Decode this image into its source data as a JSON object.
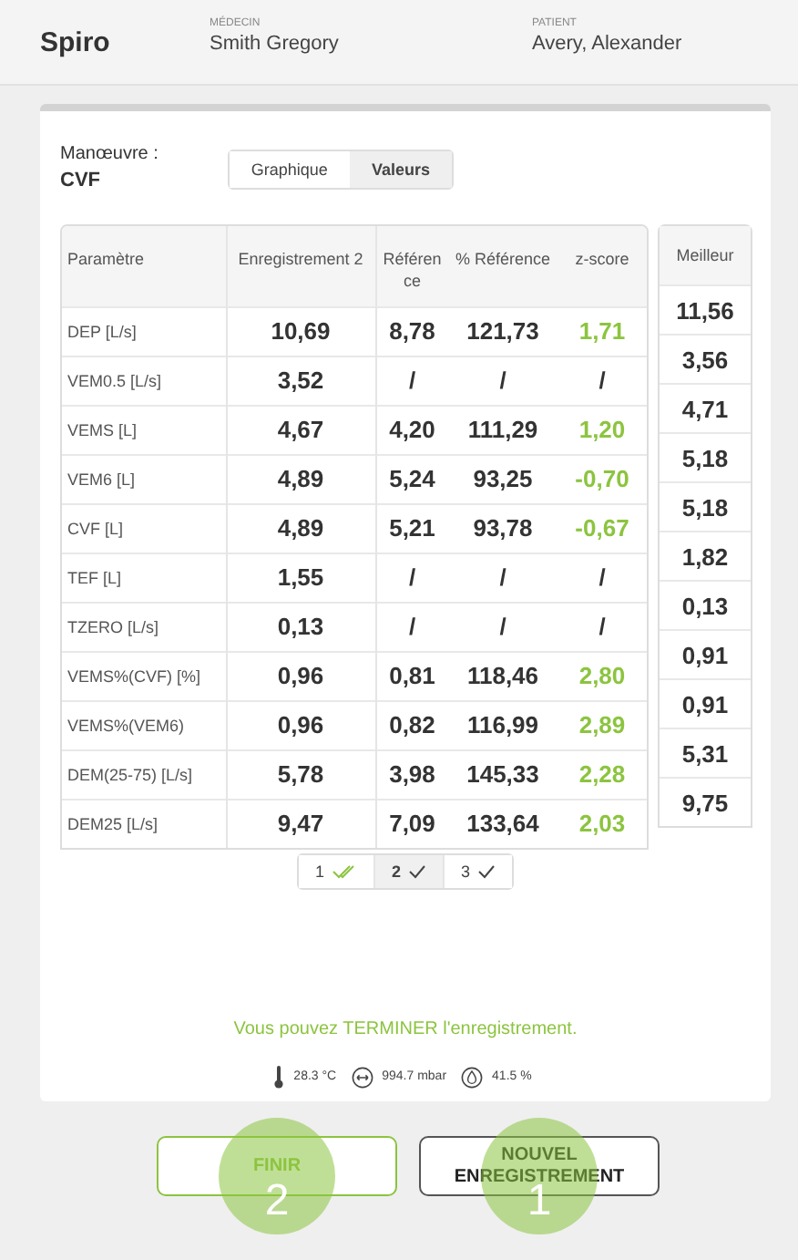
{
  "header": {
    "title": "Spiro",
    "doctor_label": "MÉDECIN",
    "doctor": "Smith Gregory",
    "patient_label": "PATIENT",
    "patient": "Avery, Alexander"
  },
  "maneuver": {
    "label": "Manœuvre :",
    "value": "CVF"
  },
  "view_tabs": [
    {
      "label": "Graphique",
      "selected": false
    },
    {
      "label": "Valeurs",
      "selected": true
    }
  ],
  "table": {
    "columns": [
      "Paramètre",
      "Enregistrement 2",
      "Référence",
      "% Référence",
      "z-score"
    ],
    "rows": [
      {
        "parameter": "DEP [L/s]",
        "recording": "10,69",
        "reference": "8,78",
        "percent": "121,73",
        "z_score": "1,71",
        "color": "#8cc43f"
      },
      {
        "parameter": "VEM0.5 [L/s]",
        "recording": "3,52",
        "reference": "/",
        "percent": "/",
        "z_score": "/",
        "color": "#333333"
      },
      {
        "parameter": "VEMS [L]",
        "recording": "4,67",
        "reference": "4,20",
        "percent": "111,29",
        "z_score": "1,20",
        "color": "#8cc43f"
      },
      {
        "parameter": "VEM6 [L]",
        "recording": "4,89",
        "reference": "5,24",
        "percent": "93,25",
        "z_score": "-0,70",
        "color": "#8cc43f"
      },
      {
        "parameter": "CVF [L]",
        "recording": "4,89",
        "reference": "5,21",
        "percent": "93,78",
        "z_score": "-0,67",
        "color": "#8cc43f"
      },
      {
        "parameter": "TEF [L]",
        "recording": "1,55",
        "reference": "/",
        "percent": "/",
        "z_score": "/",
        "color": "#333333"
      },
      {
        "parameter": "TZERO [L/s]",
        "recording": "0,13",
        "reference": "/",
        "percent": "/",
        "z_score": "/",
        "color": "#333333"
      },
      {
        "parameter": "VEMS%(CVF) [%]",
        "recording": "0,96",
        "reference": "0,81",
        "percent": "118,46",
        "z_score": "2,80",
        "color": "#8cc43f"
      },
      {
        "parameter": "VEMS%(VEM6)",
        "recording": "0,96",
        "reference": "0,82",
        "percent": "116,99",
        "z_score": "2,89",
        "color": "#8cc43f"
      },
      {
        "parameter": "DEM(25-75) [L/s]",
        "recording": "5,78",
        "reference": "3,98",
        "percent": "145,33",
        "z_score": "2,28",
        "color": "#8cc43f"
      },
      {
        "parameter": "DEM25 [L/s]",
        "recording": "9,47",
        "reference": "7,09",
        "percent": "133,64",
        "z_score": "2,03",
        "color": "#8cc43f"
      }
    ]
  },
  "best": {
    "label": "Meilleur",
    "values": [
      "11,56",
      "3,56",
      "4,71",
      "5,18",
      "5,18",
      "1,82",
      "0,13",
      "0,91",
      "0,91",
      "5,31",
      "9,75"
    ]
  },
  "recordings": [
    {
      "label": "1",
      "kind": "double",
      "selected": false
    },
    {
      "label": "2",
      "kind": "single",
      "selected": true
    },
    {
      "label": "3",
      "kind": "single",
      "selected": false
    }
  ],
  "message": "Vous pouvez TERMINER l'enregistrement.",
  "environment": {
    "temperature": "28.3 °C",
    "pressure": "994.7 mbar",
    "humidity": "41.5 %"
  },
  "buttons": [
    {
      "label": "FINIR",
      "kind": "finish",
      "badge": "2"
    },
    {
      "label": "NOUVEL ENREGISTREMENT",
      "kind": "new",
      "badge": "1"
    }
  ]
}
